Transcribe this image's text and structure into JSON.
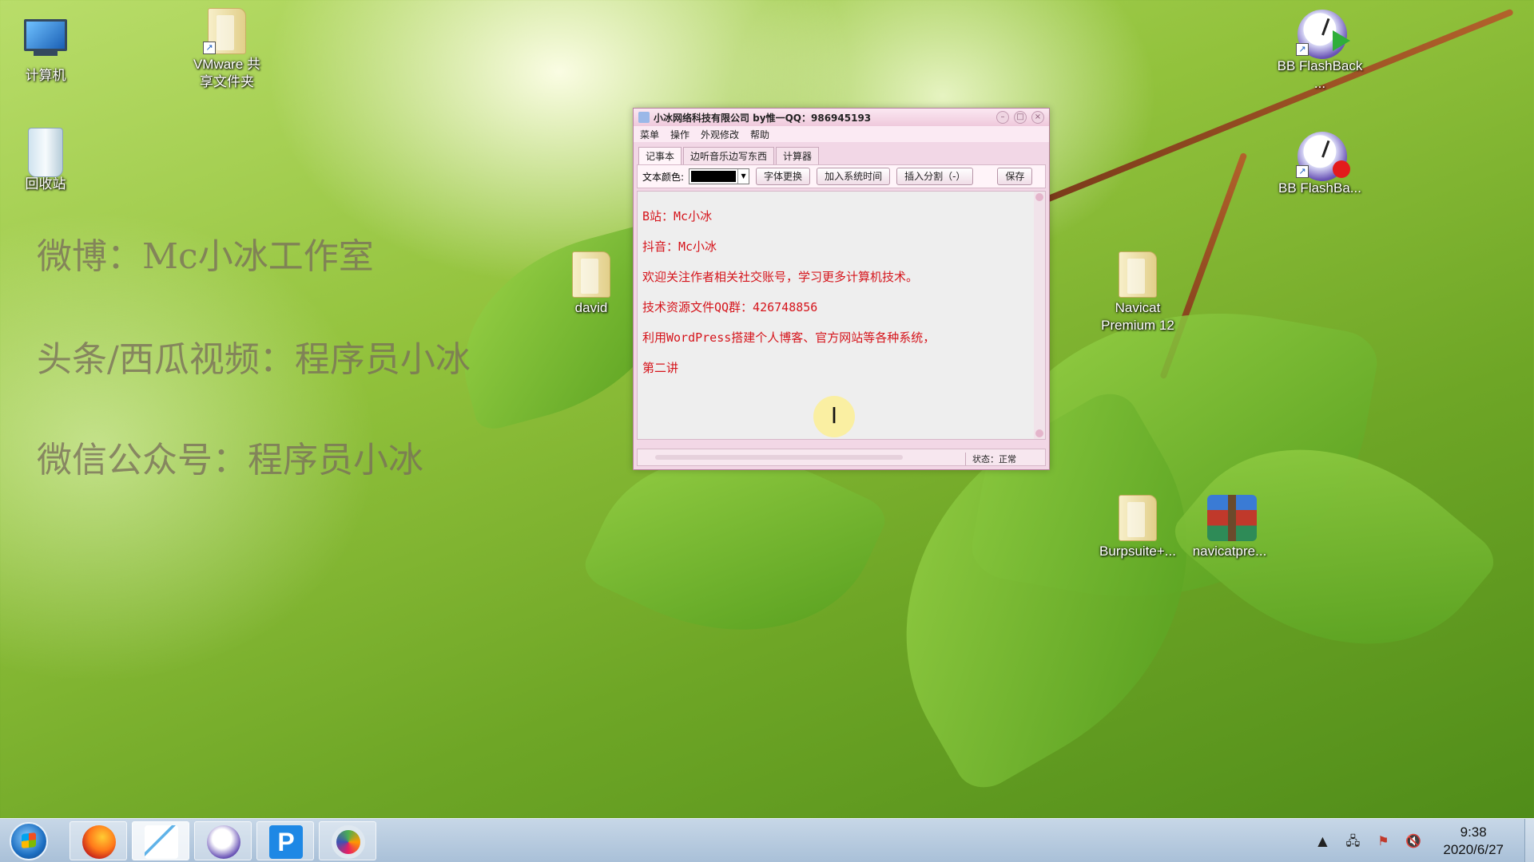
{
  "desktop_icons": [
    {
      "label": "计算机"
    },
    {
      "label": "VMware 共享文件夹"
    },
    {
      "label": "回收站"
    },
    {
      "label": "BB FlashBack ..."
    },
    {
      "label": "BB FlashBa..."
    },
    {
      "label": "david"
    },
    {
      "label": "Navicat Premium 12"
    },
    {
      "label": "Burpsuite+..."
    },
    {
      "label": "navicatpre..."
    }
  ],
  "promo": {
    "weibo": "微博：Mc小冰工作室",
    "toutiao": "头条/西瓜视频：程序员小冰",
    "wechat": "微信公众号：程序员小冰"
  },
  "window": {
    "title": "小冰网络科技有限公司 by惟一QQ：986945193",
    "menu": [
      "菜单",
      "操作",
      "外观修改",
      "帮助"
    ],
    "tabs": [
      "记事本",
      "边听音乐边写东西",
      "计算器"
    ],
    "toolbar": {
      "color_label": "文本颜色:",
      "selected_color": "#000000",
      "font_button": "字体更换",
      "time_button": "加入系统时间",
      "divider_button": "插入分割（-）",
      "save_button": "保存"
    },
    "editor_lines": [
      "B站：Mc小冰",
      "抖音：Mc小冰",
      "欢迎关注作者相关社交账号，学习更多计算机技术。",
      "技术资源文件QQ群：426748856",
      "利用WordPress搭建个人博客、官方网站等各种系统，",
      "第二讲"
    ],
    "text_color": "#d5141b",
    "status": "状态：正常",
    "cursor_glyph": "I"
  },
  "taskbar": {
    "apps": [
      "firefox-icon",
      "signature-app-icon",
      "bb-flashback-recorder-icon",
      "p-app-icon",
      "navicat-icon"
    ],
    "clock_time": "9:38",
    "clock_date": "2020/6/27"
  }
}
